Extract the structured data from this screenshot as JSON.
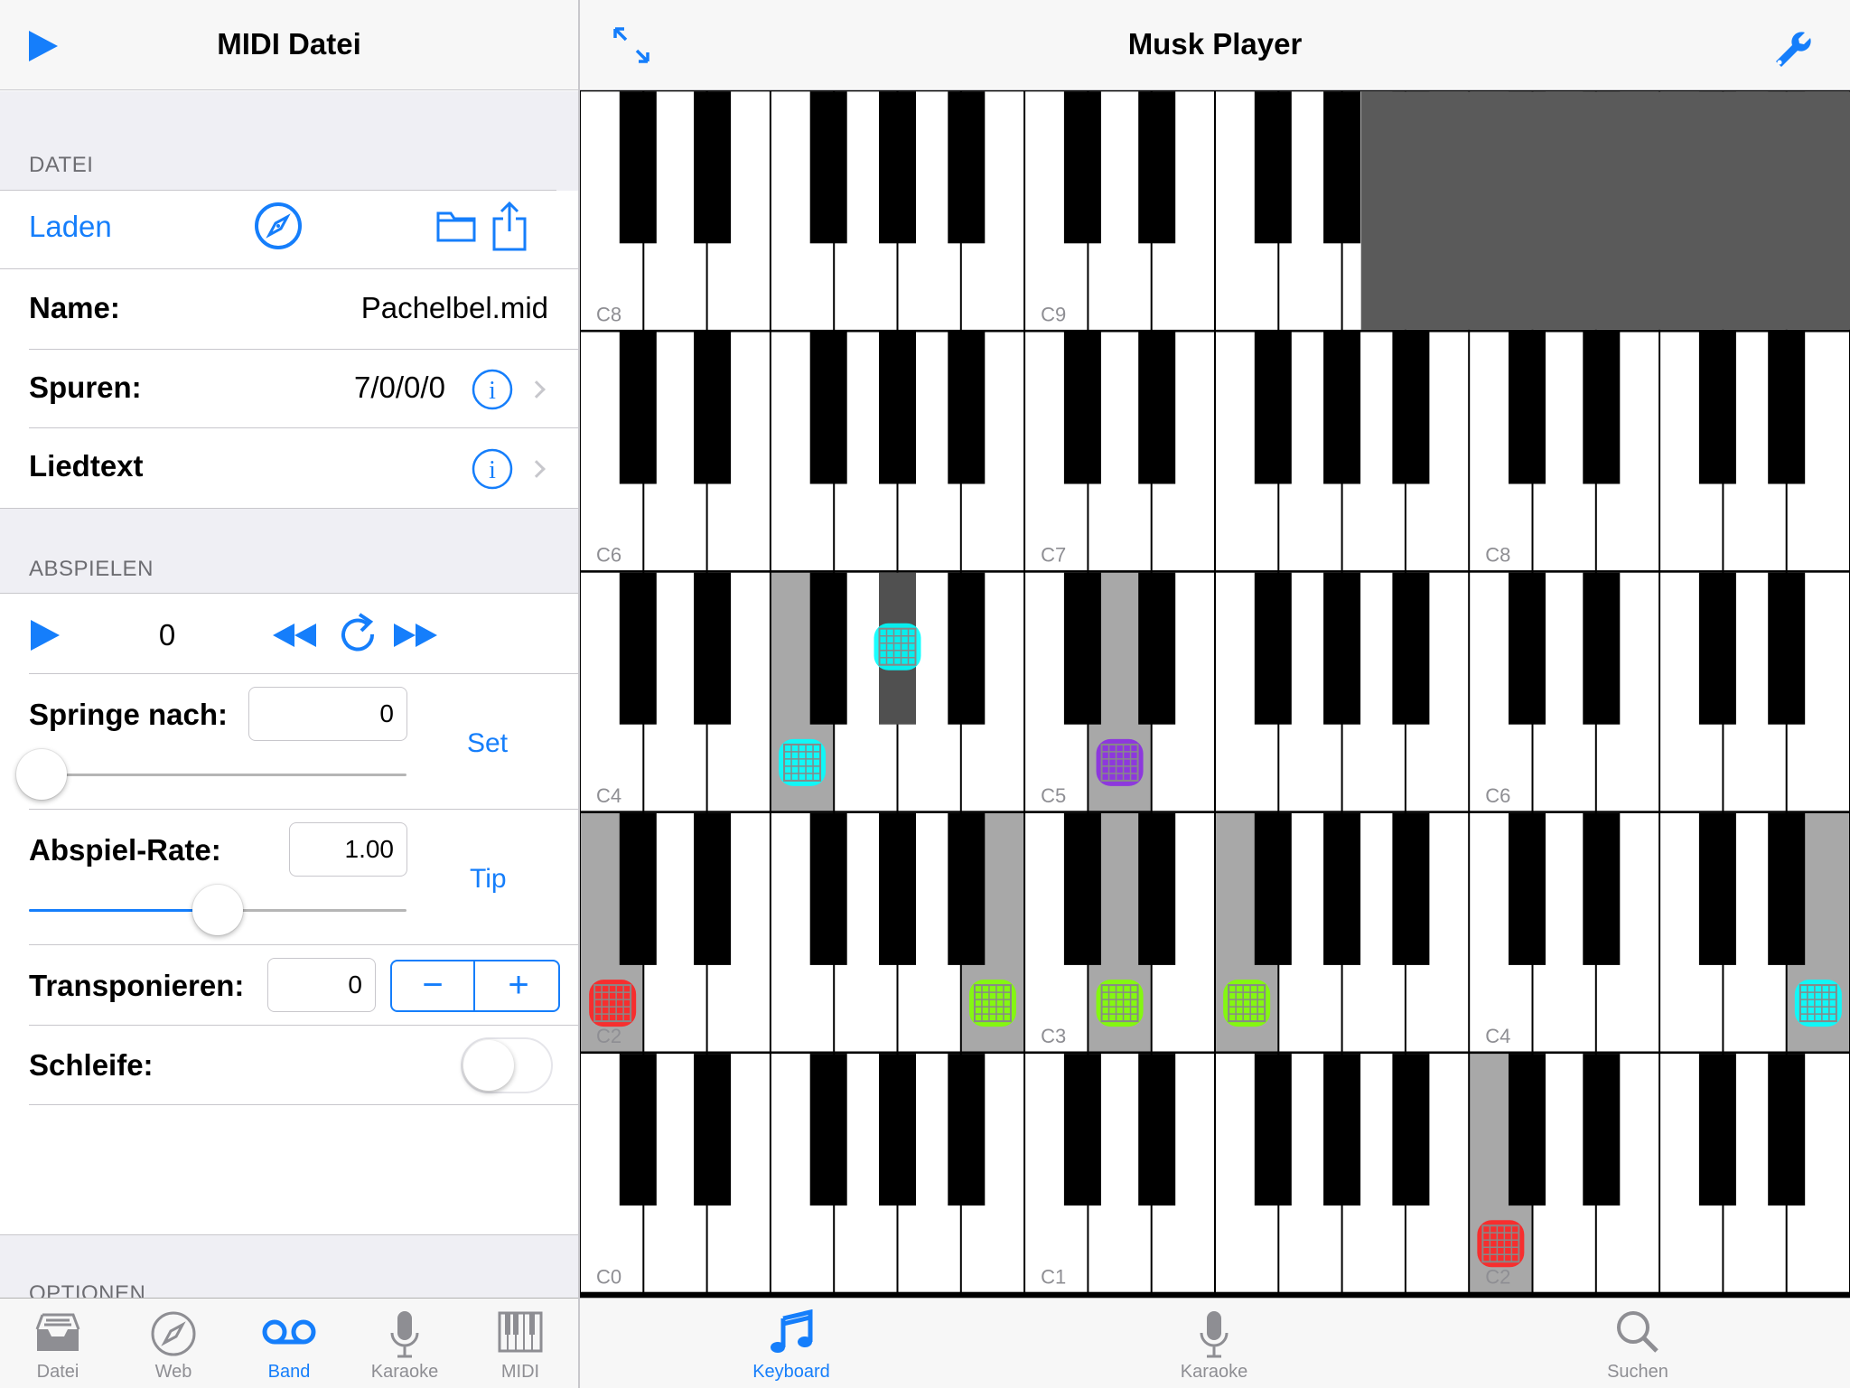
{
  "left_panel": {
    "nav_title": "MIDI Datei",
    "section_file": "DATEI",
    "load_label": "Laden",
    "name_label": "Name:",
    "name_value": "Pachelbel.mid",
    "tracks_label": "Spuren:",
    "tracks_value": "7/0/0/0",
    "lyrics_label": "Liedtext",
    "section_play": "ABSPIELEN",
    "play_position": "0",
    "jump_label": "Springe nach:",
    "jump_value": "0",
    "set_label": "Set",
    "jump_slider_fraction": 0.0,
    "rate_label": "Abspiel-Rate:",
    "rate_value": "1.00",
    "tip_label": "Tip",
    "rate_slider_fraction": 0.5,
    "transpose_label": "Transponieren:",
    "transpose_value": "0",
    "minus_label": "−",
    "plus_label": "+",
    "loop_label": "Schleife:",
    "loop_on": false,
    "section_options": "OPTIONEN"
  },
  "left_tabs": [
    {
      "label": "Datei",
      "icon": "tray-icon",
      "active": false
    },
    {
      "label": "Web",
      "icon": "compass-icon",
      "active": false
    },
    {
      "label": "Band",
      "icon": "voicemail-icon",
      "active": true
    },
    {
      "label": "Karaoke",
      "icon": "microphone-icon",
      "active": false
    },
    {
      "label": "MIDI",
      "icon": "piano-icon",
      "active": false
    }
  ],
  "right_panel": {
    "nav_title": "Musk Player"
  },
  "right_tabs": [
    {
      "label": "Keyboard",
      "icon": "music-note-icon",
      "active": true
    },
    {
      "label": "Karaoke",
      "icon": "microphone-icon",
      "active": false
    },
    {
      "label": "Suchen",
      "icon": "search-icon",
      "active": false
    }
  ],
  "keyboard": {
    "rows": [
      {
        "labels": [
          "C8",
          "C9"
        ],
        "disabled_from_fraction": 0.615
      },
      {
        "labels": [
          "C6",
          "C7",
          "C8"
        ]
      },
      {
        "labels": [
          "C4",
          "C5",
          "C6"
        ]
      },
      {
        "labels": [
          "C2",
          "C3",
          "C4"
        ]
      },
      {
        "labels": [
          "C0",
          "C1",
          "C2"
        ]
      }
    ],
    "colors": {
      "red": "#ff2020",
      "cyan": "#00ffff",
      "purple": "#8a2be2",
      "green": "#7fff00",
      "pressed": "#a8a8a8",
      "pressed_black": "#505050"
    }
  }
}
